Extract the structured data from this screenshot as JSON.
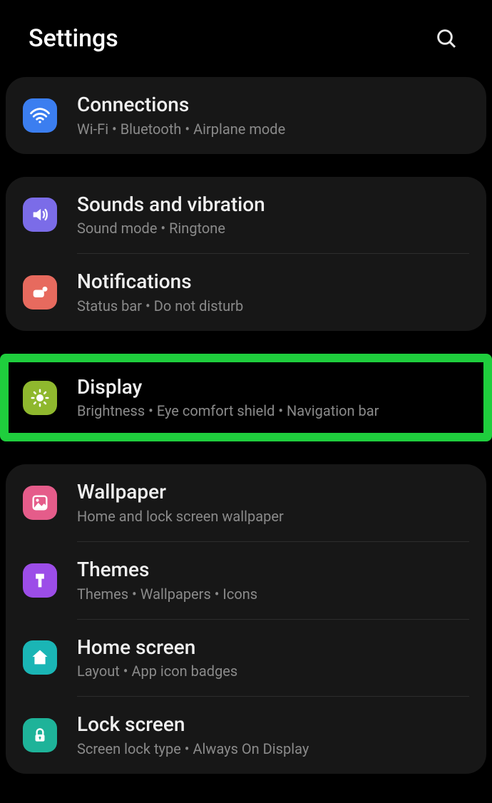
{
  "header": {
    "title": "Settings"
  },
  "groups": [
    {
      "items": [
        {
          "title": "Connections",
          "sub": "Wi-Fi  •  Bluetooth  •  Airplane mode"
        }
      ]
    },
    {
      "items": [
        {
          "title": "Sounds and vibration",
          "sub": "Sound mode  •  Ringtone"
        },
        {
          "title": "Notifications",
          "sub": "Status bar  •  Do not disturb"
        }
      ]
    },
    {
      "highlighted": true,
      "items": [
        {
          "title": "Display",
          "sub": "Brightness  •  Eye comfort shield  •  Navigation bar"
        }
      ]
    },
    {
      "items": [
        {
          "title": "Wallpaper",
          "sub": "Home and lock screen wallpaper"
        },
        {
          "title": "Themes",
          "sub": "Themes  •  Wallpapers  •  Icons"
        },
        {
          "title": "Home screen",
          "sub": "Layout  •  App icon badges"
        },
        {
          "title": "Lock screen",
          "sub": "Screen lock type  •  Always On Display"
        }
      ]
    }
  ]
}
